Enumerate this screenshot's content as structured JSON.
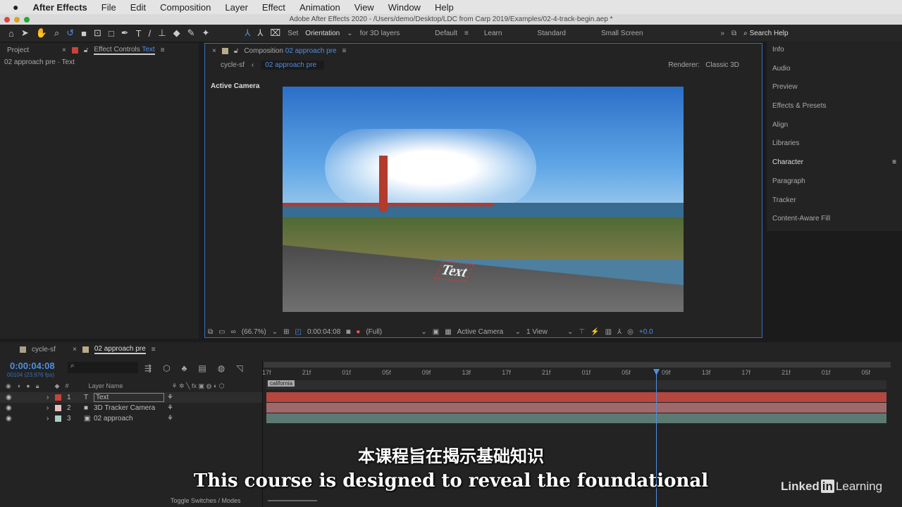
{
  "menubar": {
    "apple_icon": "apple-icon",
    "items": [
      "After Effects",
      "File",
      "Edit",
      "Composition",
      "Layer",
      "Effect",
      "Animation",
      "View",
      "Window",
      "Help"
    ]
  },
  "titlebar": {
    "title": "Adobe After Effects 2020 - /Users/demo/Desktop/LDC from Carp 2019/Examples/02-4-track-begin.aep *"
  },
  "toolbar": {
    "set_label": "Set",
    "orientation": "Orientation",
    "for_3d": "for 3D layers",
    "workspaces": [
      "Default",
      "Learn",
      "Standard",
      "Small Screen"
    ],
    "search": "Search Help"
  },
  "left_panel": {
    "tabs": [
      "Project",
      "Effect Controls",
      "Text"
    ],
    "breadcrumb": "02 approach pre · Text"
  },
  "comp_panel": {
    "tab_label": "Composition",
    "tab_comp": "02 approach pre",
    "crumbs": [
      "cycle-sf",
      "02 approach pre"
    ],
    "renderer_label": "Renderer:",
    "renderer": "Classic 3D",
    "view_label": "Active Camera",
    "overlay_text": "Text",
    "footer": {
      "zoom": "(66.7%)",
      "timecode": "0:00:04:08",
      "resolution": "(Full)",
      "camera": "Active Camera",
      "views": "1 View",
      "exposure": "+0.0"
    }
  },
  "right_panel": {
    "items": [
      "Info",
      "Audio",
      "Preview",
      "Effects & Presets",
      "Align",
      "Libraries",
      "Character",
      "Paragraph",
      "Tracker",
      "Content-Aware Fill"
    ]
  },
  "timeline": {
    "tabs": [
      "cycle-sf",
      "02 approach pre"
    ],
    "timecode": "0:00:04:08",
    "frames": "00104 (23.976 fps)",
    "col_hash": "#",
    "col_name": "Layer Name",
    "ruler": [
      "17f",
      "21f",
      "01f",
      "05f",
      "09f",
      "13f",
      "17f",
      "21f",
      "01f",
      "05f",
      "09f",
      "13f",
      "17f",
      "21f",
      "01f",
      "05f"
    ],
    "marker": "california",
    "layers": [
      {
        "num": "1",
        "name": "Text",
        "color": "#c8433a",
        "bar": "#b5473f"
      },
      {
        "num": "2",
        "name": "3D Tracker Camera",
        "color": "#e7c0c4",
        "bar": "#a0686b"
      },
      {
        "num": "3",
        "name": "02 approach",
        "color": "#a8cfc0",
        "bar": "#5c7a72"
      }
    ],
    "toggle": "Toggle Switches / Modes"
  },
  "subtitles": {
    "zh": "本课程旨在揭示基础知识",
    "en": "This course is designed to reveal the foundational"
  },
  "brand": {
    "linkedin": "Linked",
    "in": "in",
    "learning": "Learning"
  }
}
